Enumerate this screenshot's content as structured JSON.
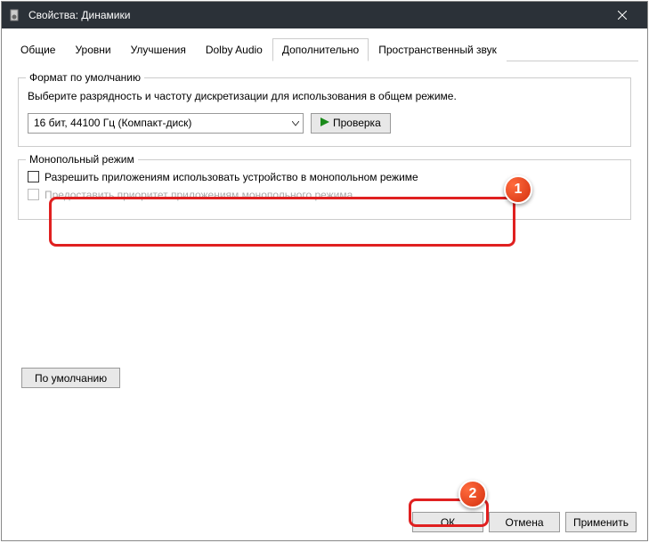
{
  "window": {
    "title": "Свойства: Динамики"
  },
  "tabs": {
    "general": "Общие",
    "levels": "Уровни",
    "enhancements": "Улучшения",
    "dolby": "Dolby Audio",
    "advanced": "Дополнительно",
    "spatial": "Пространственный звук"
  },
  "defaultFormat": {
    "groupTitle": "Формат по умолчанию",
    "instruction": "Выберите разрядность и частоту дискретизации для использования в общем режиме.",
    "selected": "16 бит, 44100 Гц (Компакт-диск)",
    "testLabel": "Проверка"
  },
  "exclusiveMode": {
    "groupTitle": "Монопольный режим",
    "allowLabel": "Разрешить приложениям использовать устройство в монопольном режиме",
    "priorityLabel": "Предоставить приоритет приложениям монопольного режима"
  },
  "restoreDefaults": "По умолчанию",
  "buttons": {
    "ok": "ОК",
    "cancel": "Отмена",
    "apply": "Применить"
  },
  "badges": {
    "one": "1",
    "two": "2"
  }
}
